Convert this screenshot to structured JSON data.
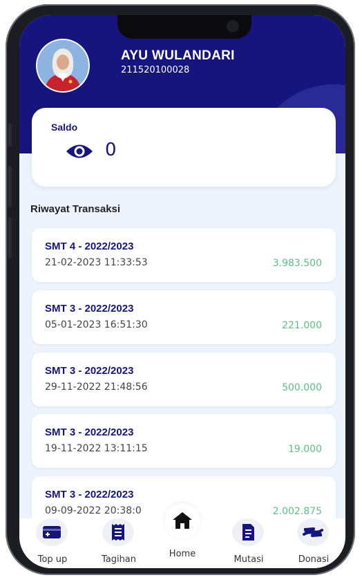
{
  "user": {
    "name": "AYU WULANDARI",
    "id": "211520100028"
  },
  "saldo": {
    "label": "Saldo",
    "value": "0",
    "icon": "eye-icon"
  },
  "history": {
    "title": "Riwayat Transaksi",
    "items": [
      {
        "semester": "SMT 4 - 2022/2023",
        "datetime": "21-02-2023 11:33:53",
        "amount": "3.983.500"
      },
      {
        "semester": "SMT 3 - 2022/2023",
        "datetime": "05-01-2023 16:51:30",
        "amount": "221.000"
      },
      {
        "semester": "SMT 3 - 2022/2023",
        "datetime": "29-11-2022 21:48:56",
        "amount": "500.000"
      },
      {
        "semester": "SMT 3 - 2022/2023",
        "datetime": "19-11-2022 13:11:15",
        "amount": "19.000"
      },
      {
        "semester": "SMT 3 - 2022/2023",
        "datetime": "09-09-2022 20:38:0",
        "amount": "2.002.875"
      }
    ]
  },
  "nav": {
    "items": [
      {
        "label": "Top up",
        "icon": "wallet-plus-icon"
      },
      {
        "label": "Tagihan",
        "icon": "receipt-icon"
      },
      {
        "label": "Home",
        "icon": "home-icon"
      },
      {
        "label": "Mutasi",
        "icon": "document-icon"
      },
      {
        "label": "Donasi",
        "icon": "hand-give-icon"
      }
    ]
  },
  "colors": {
    "primary": "#16157e",
    "amount": "#5cbf84",
    "background": "#eef4fd"
  }
}
